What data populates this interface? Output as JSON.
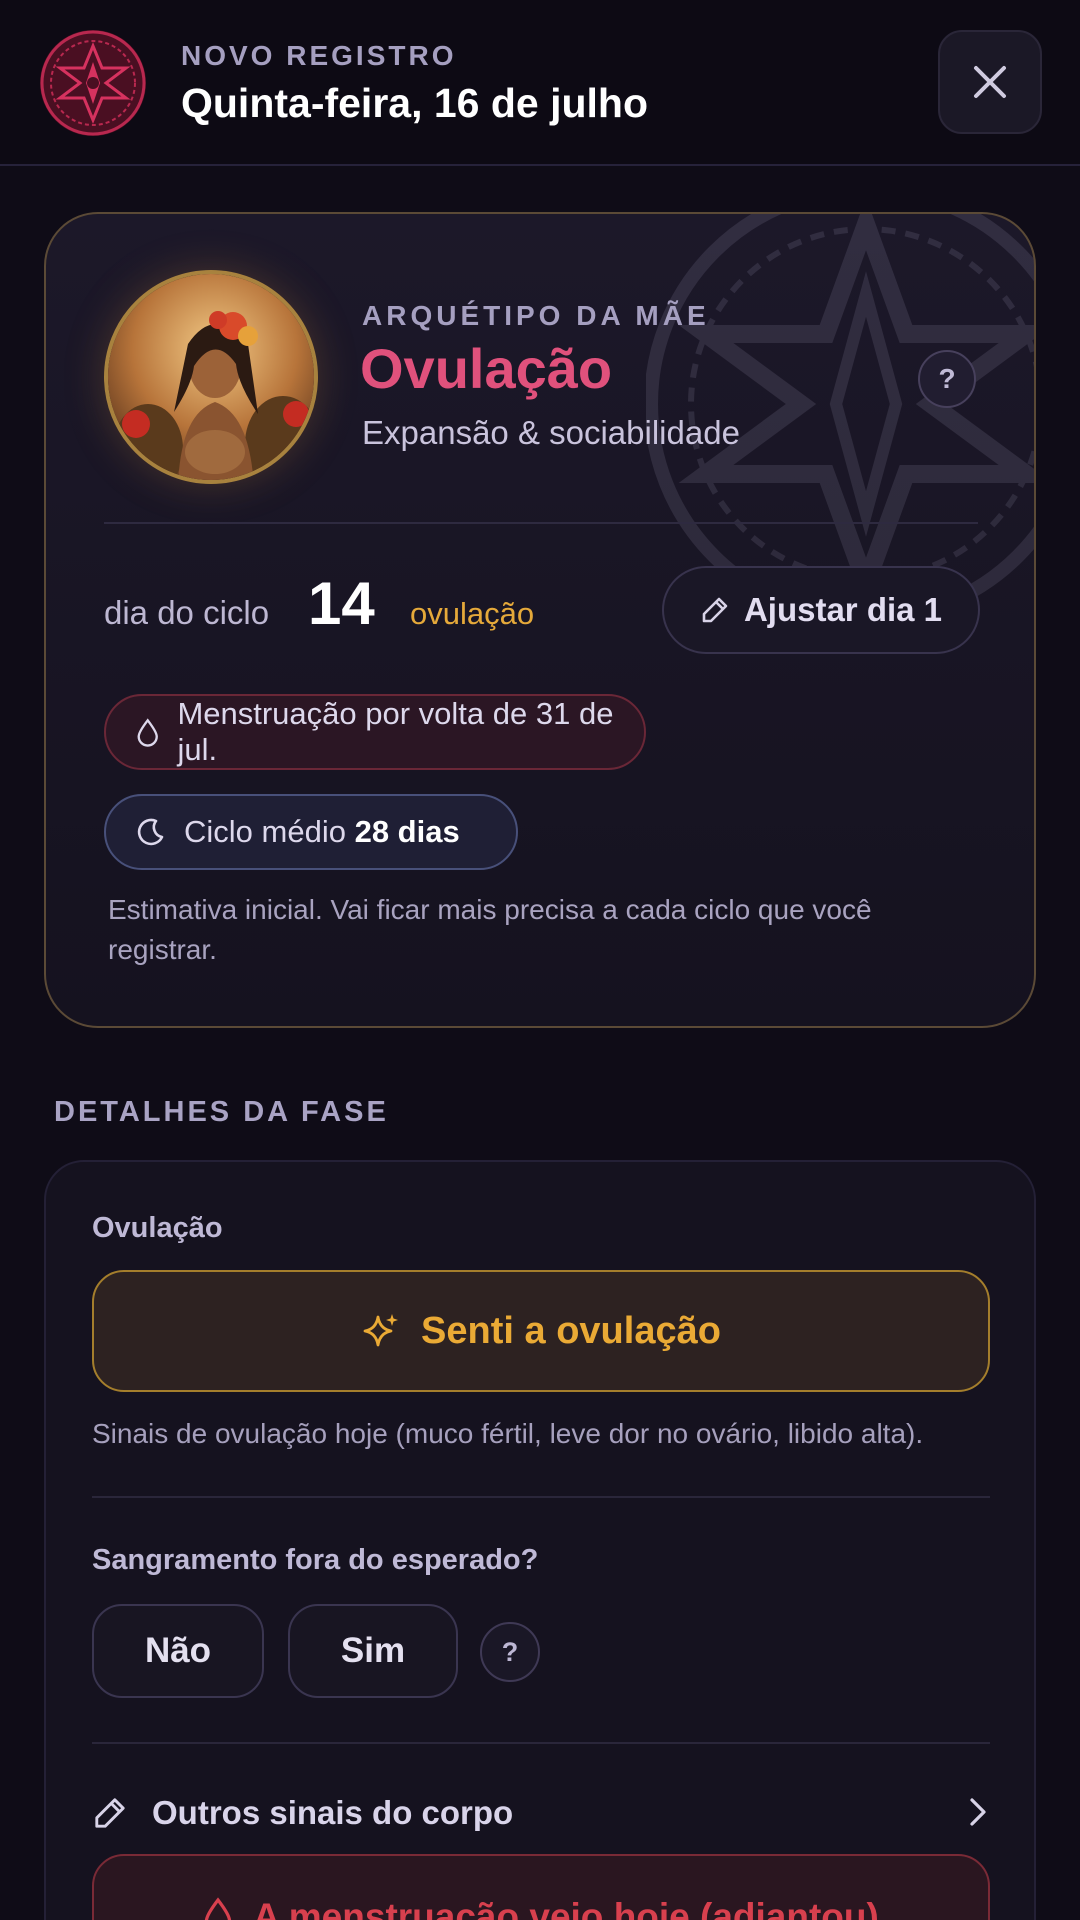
{
  "header": {
    "kicker": "NOVO REGISTRO",
    "title": "Quinta-feira, 16 de julho",
    "logo_icon": "mandala-logo-icon",
    "close_icon": "close-icon"
  },
  "phase_card": {
    "archetype": "ARQUÉTIPO DA MÃE",
    "phase_name": "Ovulação",
    "phase_subtitle": "Expansão & sociabilidade",
    "help_label": "?",
    "cycle_label": "dia do ciclo",
    "cycle_day": "14",
    "cycle_phase": "ovulação",
    "adjust_label": "Ajustar dia 1",
    "menstruation_pill": "Menstruação por volta de 31 de jul.",
    "avg_cycle_prefix": "Ciclo médio",
    "avg_cycle_value": "28 dias",
    "estimate_note": "Estimativa inicial. Vai ficar mais precisa a cada ciclo que você registrar."
  },
  "details": {
    "heading": "DETALHES DA FASE",
    "ovulation_label": "Ovulação",
    "ovulation_button": "Senti a ovulação",
    "ovulation_desc": "Sinais de ovulação hoje (muco fértil, leve dor no ovário, libido alta).",
    "bleeding_label": "Sangramento fora do esperado?",
    "no_label": "Não",
    "yes_label": "Sim",
    "help_label": "?",
    "body_signs_label": "Outros sinais do corpo",
    "period_early_button": "A menstruação veio hoje (adiantou)"
  },
  "colors": {
    "background": "#0f0c17",
    "accent_pink": "#e0517c",
    "accent_gold": "#e5a93a",
    "danger_red": "#d8404e"
  }
}
